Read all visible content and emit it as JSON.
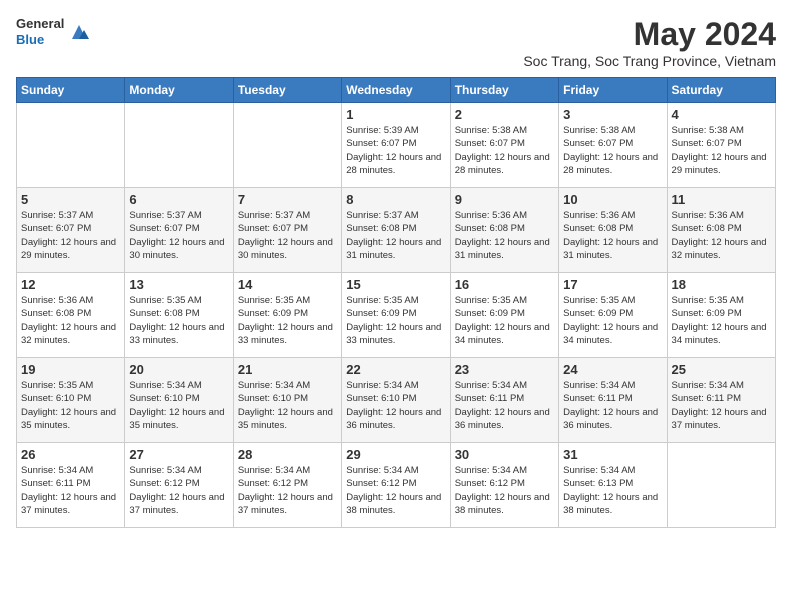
{
  "header": {
    "logo": {
      "general": "General",
      "blue": "Blue"
    },
    "title": "May 2024",
    "location": "Soc Trang, Soc Trang Province, Vietnam"
  },
  "days_of_week": [
    "Sunday",
    "Monday",
    "Tuesday",
    "Wednesday",
    "Thursday",
    "Friday",
    "Saturday"
  ],
  "weeks": [
    [
      {
        "day": "",
        "info": ""
      },
      {
        "day": "",
        "info": ""
      },
      {
        "day": "",
        "info": ""
      },
      {
        "day": "1",
        "info": "Sunrise: 5:39 AM\nSunset: 6:07 PM\nDaylight: 12 hours and 28 minutes."
      },
      {
        "day": "2",
        "info": "Sunrise: 5:38 AM\nSunset: 6:07 PM\nDaylight: 12 hours and 28 minutes."
      },
      {
        "day": "3",
        "info": "Sunrise: 5:38 AM\nSunset: 6:07 PM\nDaylight: 12 hours and 28 minutes."
      },
      {
        "day": "4",
        "info": "Sunrise: 5:38 AM\nSunset: 6:07 PM\nDaylight: 12 hours and 29 minutes."
      }
    ],
    [
      {
        "day": "5",
        "info": "Sunrise: 5:37 AM\nSunset: 6:07 PM\nDaylight: 12 hours and 29 minutes."
      },
      {
        "day": "6",
        "info": "Sunrise: 5:37 AM\nSunset: 6:07 PM\nDaylight: 12 hours and 30 minutes."
      },
      {
        "day": "7",
        "info": "Sunrise: 5:37 AM\nSunset: 6:07 PM\nDaylight: 12 hours and 30 minutes."
      },
      {
        "day": "8",
        "info": "Sunrise: 5:37 AM\nSunset: 6:08 PM\nDaylight: 12 hours and 31 minutes."
      },
      {
        "day": "9",
        "info": "Sunrise: 5:36 AM\nSunset: 6:08 PM\nDaylight: 12 hours and 31 minutes."
      },
      {
        "day": "10",
        "info": "Sunrise: 5:36 AM\nSunset: 6:08 PM\nDaylight: 12 hours and 31 minutes."
      },
      {
        "day": "11",
        "info": "Sunrise: 5:36 AM\nSunset: 6:08 PM\nDaylight: 12 hours and 32 minutes."
      }
    ],
    [
      {
        "day": "12",
        "info": "Sunrise: 5:36 AM\nSunset: 6:08 PM\nDaylight: 12 hours and 32 minutes."
      },
      {
        "day": "13",
        "info": "Sunrise: 5:35 AM\nSunset: 6:08 PM\nDaylight: 12 hours and 33 minutes."
      },
      {
        "day": "14",
        "info": "Sunrise: 5:35 AM\nSunset: 6:09 PM\nDaylight: 12 hours and 33 minutes."
      },
      {
        "day": "15",
        "info": "Sunrise: 5:35 AM\nSunset: 6:09 PM\nDaylight: 12 hours and 33 minutes."
      },
      {
        "day": "16",
        "info": "Sunrise: 5:35 AM\nSunset: 6:09 PM\nDaylight: 12 hours and 34 minutes."
      },
      {
        "day": "17",
        "info": "Sunrise: 5:35 AM\nSunset: 6:09 PM\nDaylight: 12 hours and 34 minutes."
      },
      {
        "day": "18",
        "info": "Sunrise: 5:35 AM\nSunset: 6:09 PM\nDaylight: 12 hours and 34 minutes."
      }
    ],
    [
      {
        "day": "19",
        "info": "Sunrise: 5:35 AM\nSunset: 6:10 PM\nDaylight: 12 hours and 35 minutes."
      },
      {
        "day": "20",
        "info": "Sunrise: 5:34 AM\nSunset: 6:10 PM\nDaylight: 12 hours and 35 minutes."
      },
      {
        "day": "21",
        "info": "Sunrise: 5:34 AM\nSunset: 6:10 PM\nDaylight: 12 hours and 35 minutes."
      },
      {
        "day": "22",
        "info": "Sunrise: 5:34 AM\nSunset: 6:10 PM\nDaylight: 12 hours and 36 minutes."
      },
      {
        "day": "23",
        "info": "Sunrise: 5:34 AM\nSunset: 6:11 PM\nDaylight: 12 hours and 36 minutes."
      },
      {
        "day": "24",
        "info": "Sunrise: 5:34 AM\nSunset: 6:11 PM\nDaylight: 12 hours and 36 minutes."
      },
      {
        "day": "25",
        "info": "Sunrise: 5:34 AM\nSunset: 6:11 PM\nDaylight: 12 hours and 37 minutes."
      }
    ],
    [
      {
        "day": "26",
        "info": "Sunrise: 5:34 AM\nSunset: 6:11 PM\nDaylight: 12 hours and 37 minutes."
      },
      {
        "day": "27",
        "info": "Sunrise: 5:34 AM\nSunset: 6:12 PM\nDaylight: 12 hours and 37 minutes."
      },
      {
        "day": "28",
        "info": "Sunrise: 5:34 AM\nSunset: 6:12 PM\nDaylight: 12 hours and 37 minutes."
      },
      {
        "day": "29",
        "info": "Sunrise: 5:34 AM\nSunset: 6:12 PM\nDaylight: 12 hours and 38 minutes."
      },
      {
        "day": "30",
        "info": "Sunrise: 5:34 AM\nSunset: 6:12 PM\nDaylight: 12 hours and 38 minutes."
      },
      {
        "day": "31",
        "info": "Sunrise: 5:34 AM\nSunset: 6:13 PM\nDaylight: 12 hours and 38 minutes."
      },
      {
        "day": "",
        "info": ""
      }
    ]
  ]
}
